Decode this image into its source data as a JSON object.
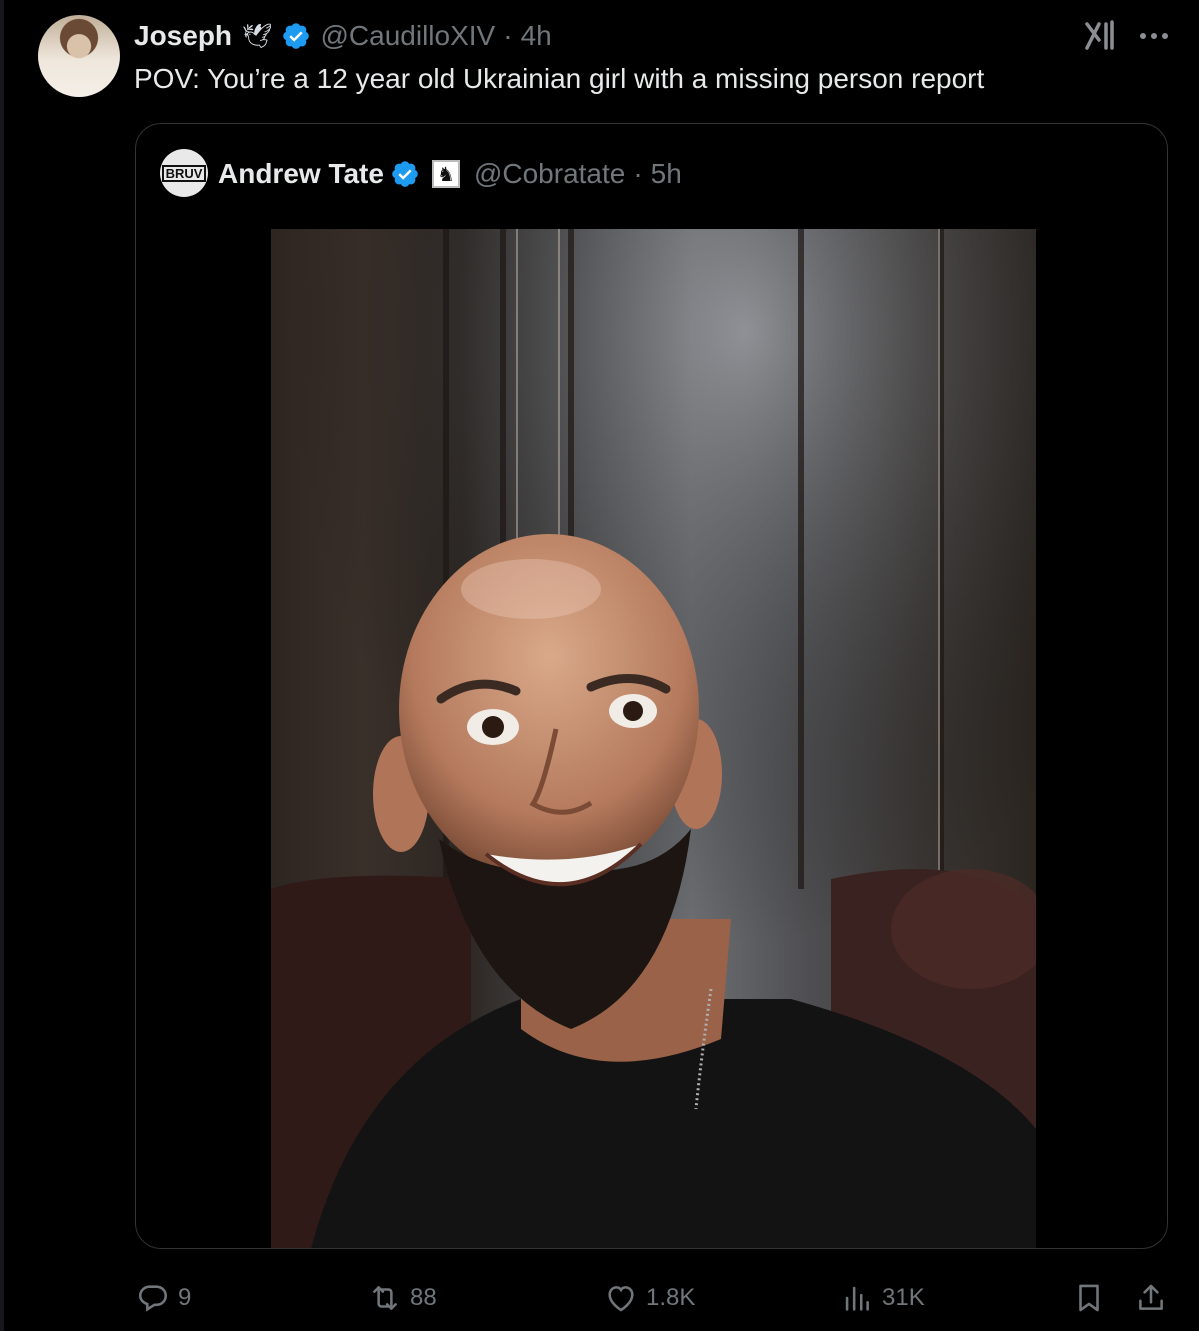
{
  "tweet": {
    "author_name": "Joseph",
    "author_emoji": "🕊",
    "author_handle": "@CaudilloXIV",
    "separator": "·",
    "time": "4h",
    "text": "POV: You’re a 12 year old Ukrainian girl with a missing person report"
  },
  "quoted": {
    "author_name": "Andrew Tate",
    "avatar_text": "BRUV",
    "badge_glyph": "♞",
    "author_handle": "@Cobratate",
    "separator": "·",
    "time": "5h"
  },
  "actions": {
    "replies": "9",
    "reposts": "88",
    "likes": "1.8K",
    "views": "31K"
  },
  "icons": {
    "verified": "verified-badge-icon",
    "grok": "grok-icon",
    "more": "more-options-icon",
    "reply": "reply-icon",
    "repost": "repost-icon",
    "like": "heart-icon",
    "views": "views-chart-icon",
    "bookmark": "bookmark-icon",
    "share": "share-icon"
  },
  "colors": {
    "background": "#000000",
    "text": "#e7e9ea",
    "muted": "#71767b",
    "verified": "#1d9bf0",
    "border": "#2f3336"
  }
}
